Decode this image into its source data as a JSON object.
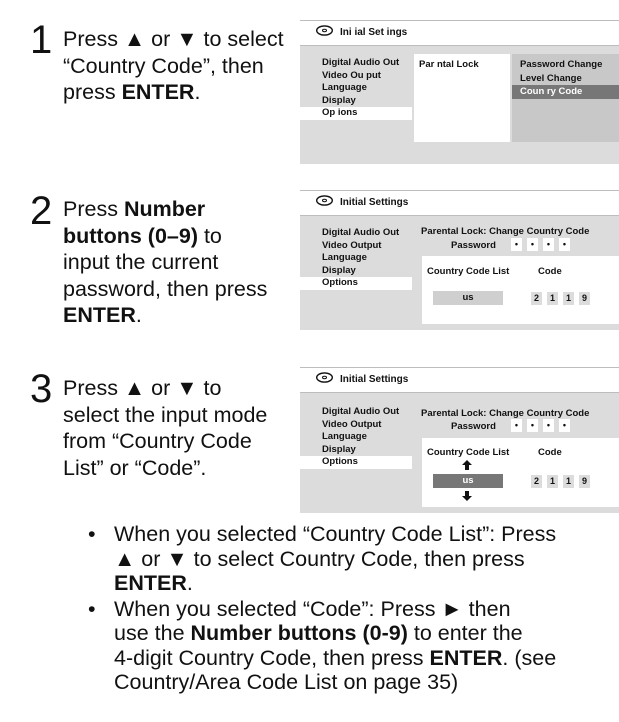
{
  "steps": [
    {
      "number": "1",
      "lines": [
        [
          "Press ▲ or ▼ to select"
        ],
        [
          "“Country Code”, then"
        ],
        [
          "press ",
          {
            "b": "ENTER"
          },
          "."
        ]
      ]
    },
    {
      "number": "2",
      "lines": [
        [
          "Press ",
          {
            "b": "Number"
          }
        ],
        [
          {
            "b": "buttons (0–9)"
          },
          " to"
        ],
        [
          "input the current"
        ],
        [
          "password, then press"
        ],
        [
          {
            "b": "ENTER"
          },
          "."
        ]
      ]
    },
    {
      "number": "3",
      "lines": [
        [
          "Press ▲ or ▼ to"
        ],
        [
          "select the input mode"
        ],
        [
          "from “Country Code"
        ],
        [
          "List” or “Code”."
        ]
      ]
    }
  ],
  "panel1": {
    "title": "Ini ial Set ings",
    "menu": [
      "Digital Audio Out",
      "Video Ou put",
      "Language",
      "Display",
      "Op ions"
    ],
    "selected_index": 4,
    "submenu": "Par ntal Lock",
    "options": [
      "Password Change",
      "Level Change",
      "Coun ry Code"
    ],
    "highlighted_option": 2
  },
  "panel2": {
    "title": "Initial Settings",
    "menu": [
      "Digital Audio Out",
      "Video Output",
      "Language",
      "Display",
      "Options"
    ],
    "selected_index": 4,
    "heading": "Parental Lock: Change Country Code",
    "password_label": "Password",
    "password_dots": [
      "•",
      "•",
      "•",
      "•"
    ],
    "list_label": "Country Code List",
    "code_label": "Code",
    "country": "us",
    "code_digits": [
      "2",
      "1",
      "1",
      "9"
    ]
  },
  "panel3": {
    "title": "Initial Settings",
    "menu": [
      "Digital Audio Out",
      "Video Output",
      "Language",
      "Display",
      "Options"
    ],
    "selected_index": 4,
    "heading": "Parental Lock: Change Country Code",
    "password_label": "Password",
    "password_dots": [
      "•",
      "•",
      "•",
      "•"
    ],
    "list_label": "Country Code List",
    "code_label": "Code",
    "country": "us",
    "code_digits": [
      "2",
      "1",
      "1",
      "9"
    ]
  },
  "bullets": [
    [
      [
        "• "
      ],
      [
        "When you selected “Country Code List”: Press"
      ],
      [
        "▲ or ▼ to select Country Code, then press"
      ],
      [
        {
          "b": "ENTER"
        },
        "."
      ]
    ],
    [
      [
        "• "
      ],
      [
        "When you selected “Code”: Press ► then"
      ],
      [
        "use the ",
        {
          "b": "Number buttons (0-9)"
        },
        " to enter the"
      ],
      [
        "4-digit Country Code, then press ",
        {
          "b": "ENTER"
        },
        ". (see"
      ],
      [
        "Country/Area Code List on page 35)"
      ]
    ]
  ]
}
